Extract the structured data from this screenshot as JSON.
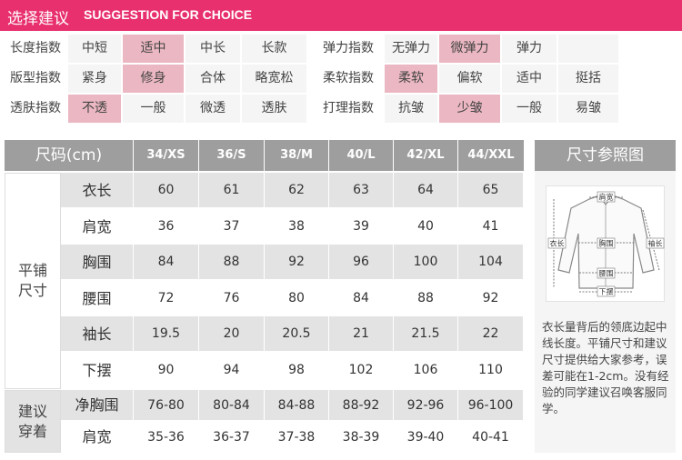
{
  "header": {
    "title_cn": "选择建议",
    "title_en": "SUGGESTION FOR CHOICE"
  },
  "suggestion": {
    "rows": [
      [
        {
          "label": "长度指数",
          "options": [
            {
              "text": "中短",
              "hl": false
            },
            {
              "text": "适中",
              "hl": true
            },
            {
              "text": "中长",
              "hl": false
            },
            {
              "text": "长款",
              "hl": false
            }
          ]
        },
        {
          "label": "弹力指数",
          "options": [
            {
              "text": "无弹力",
              "hl": false
            },
            {
              "text": "微弹力",
              "hl": true
            },
            {
              "text": "弹力",
              "hl": false
            },
            {
              "text": "",
              "hl": false
            }
          ]
        }
      ],
      [
        {
          "label": "版型指数",
          "options": [
            {
              "text": "紧身",
              "hl": false
            },
            {
              "text": "修身",
              "hl": true
            },
            {
              "text": "合体",
              "hl": false
            },
            {
              "text": "略宽松",
              "hl": false
            }
          ]
        },
        {
          "label": "柔软指数",
          "options": [
            {
              "text": "柔软",
              "hl": true
            },
            {
              "text": "偏软",
              "hl": false
            },
            {
              "text": "适中",
              "hl": false
            },
            {
              "text": "挺括",
              "hl": false
            }
          ]
        }
      ],
      [
        {
          "label": "透肤指数",
          "options": [
            {
              "text": "不透",
              "hl": true
            },
            {
              "text": "一般",
              "hl": false
            },
            {
              "text": "微透",
              "hl": false
            },
            {
              "text": "透肤",
              "hl": false
            }
          ]
        },
        {
          "label": "打理指数",
          "options": [
            {
              "text": "抗皱",
              "hl": false
            },
            {
              "text": "少皱",
              "hl": true
            },
            {
              "text": "一般",
              "hl": false
            },
            {
              "text": "易皱",
              "hl": false
            }
          ]
        }
      ]
    ]
  },
  "size_table": {
    "corner": "尺码(cm)",
    "sizes": [
      "34/XS",
      "36/S",
      "38/M",
      "40/L",
      "42/XL",
      "44/XXL"
    ],
    "groups": [
      {
        "name": "平铺尺寸",
        "rows": [
          {
            "label": "衣长",
            "values": [
              "60",
              "61",
              "62",
              "63",
              "64",
              "65"
            ]
          },
          {
            "label": "肩宽",
            "values": [
              "36",
              "37",
              "38",
              "39",
              "40",
              "41"
            ]
          },
          {
            "label": "胸围",
            "values": [
              "84",
              "88",
              "92",
              "96",
              "100",
              "104"
            ]
          },
          {
            "label": "腰围",
            "values": [
              "72",
              "76",
              "80",
              "84",
              "88",
              "92"
            ]
          },
          {
            "label": "袖长",
            "values": [
              "19.5",
              "20",
              "20.5",
              "21",
              "21.5",
              "22"
            ]
          },
          {
            "label": "下摆",
            "values": [
              "90",
              "94",
              "98",
              "102",
              "106",
              "110"
            ]
          }
        ]
      },
      {
        "name": "建议穿着",
        "rows": [
          {
            "label": "净胸围",
            "values": [
              "76-80",
              "80-84",
              "84-88",
              "88-92",
              "92-96",
              "96-100"
            ]
          },
          {
            "label": "肩宽",
            "values": [
              "35-36",
              "36-37",
              "37-38",
              "38-39",
              "39-40",
              "40-41"
            ]
          }
        ]
      }
    ]
  },
  "reference": {
    "title": "尺寸参照图",
    "diagram_labels": {
      "shoulder": "肩宽",
      "length": "衣长",
      "chest": "胸围",
      "sleeve": "袖长",
      "waist": "腰围",
      "hem": "下摆"
    },
    "note": "衣长量背后的领底边起中线长度。平铺尺寸和建议尺寸提供给大家参考，误差可能在1-2cm。没有经验的同学建议召唤客服同学。"
  },
  "colors": {
    "accent": "#e8306e",
    "highlight": "#ebb7c2",
    "header_gray": "#9e9e9e",
    "row_shade": "#e3e3e3"
  }
}
